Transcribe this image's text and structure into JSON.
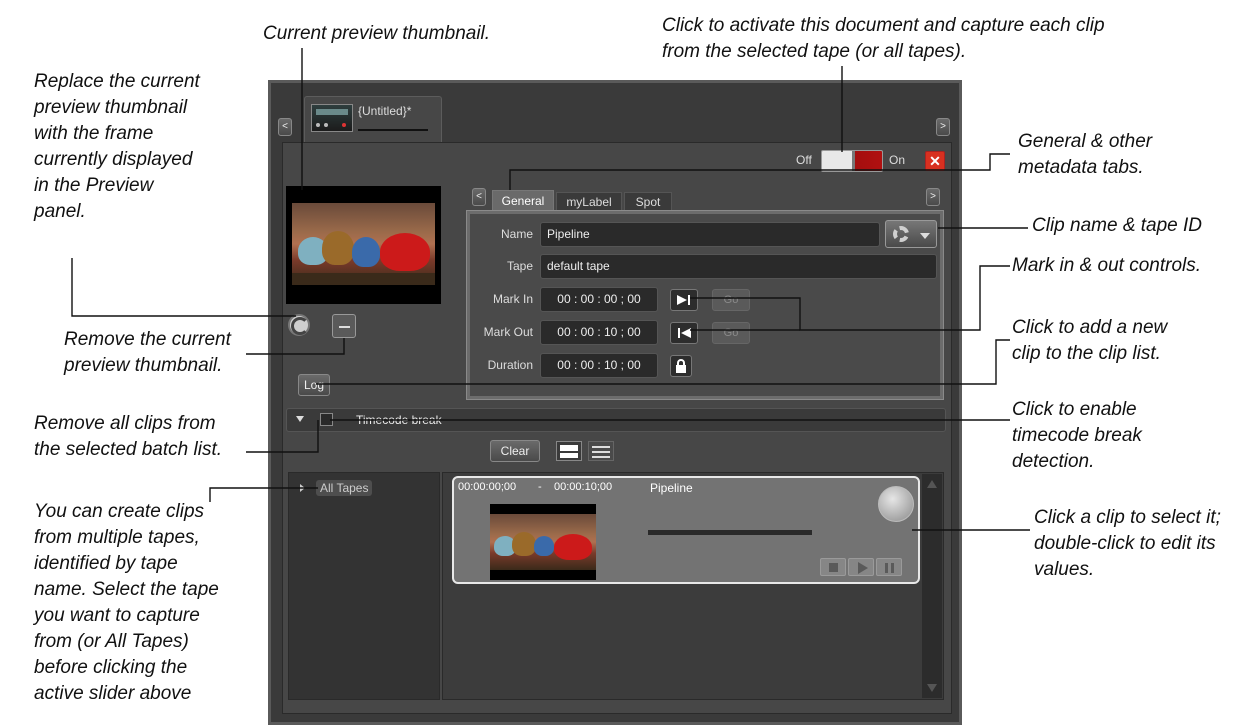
{
  "annotations": {
    "thumbnail": "Current preview thumbnail.",
    "activate_1": "Click to activate this document and capture each clip",
    "activate_2": "from the selected tape (or all tapes).",
    "replace_1": "Replace the current",
    "replace_2": "preview thumbnail",
    "replace_3": "with the frame",
    "replace_4": "currently displayed",
    "replace_5": "in the Preview",
    "replace_6": "panel.",
    "tabs_1": "General & other",
    "tabs_2": "metadata tabs.",
    "clipname": "Clip name & tape ID",
    "mark": "Mark in & out controls.",
    "remove_1": "Remove the current",
    "remove_2": "preview thumbnail.",
    "addclip_1": "Click to add a new",
    "addclip_2": "clip to the clip list.",
    "clearall_1": "Remove all clips from",
    "clearall_2": "the selected batch list.",
    "tcbreak_1": "Click to enable",
    "tcbreak_2": "timecode break",
    "tcbreak_3": "detection.",
    "tapes_1": "You can create clips",
    "tapes_2": "from multiple tapes,",
    "tapes_3": "identified by tape",
    "tapes_4": "name. Select the tape",
    "tapes_5": "you want to capture",
    "tapes_6": "from (or All Tapes)",
    "tapes_7": "before clicking the",
    "tapes_8": "active slider above",
    "select_1": "Click a clip to select it;",
    "select_2": "double-click to edit its",
    "select_3": "values."
  },
  "window": {
    "doc_tab_title": "{Untitled}*",
    "scroll_left": "<",
    "scroll_right": ">",
    "toggle_off": "Off",
    "toggle_on": "On",
    "close": "✕"
  },
  "tabs": [
    "General",
    "myLabel",
    "Spot"
  ],
  "form": {
    "name_label": "Name",
    "name_value": "Pipeline",
    "tape_label": "Tape",
    "tape_value": "default tape",
    "markin_label": "Mark In",
    "markin_value": "00 : 00 : 00 ; 00",
    "markout_label": "Mark Out",
    "markout_value": "00 : 00 : 10 ; 00",
    "duration_label": "Duration",
    "duration_value": "00 : 00 : 10 ; 00",
    "go": "Go"
  },
  "log_button": "Log",
  "timecode_break_label": "Timecode break",
  "clear_button": "Clear",
  "tape_tree": {
    "item": "All Tapes"
  },
  "clip": {
    "in": "00:00:00;00",
    "sep": "-",
    "out": "00:00:10;00",
    "name": "Pipeline"
  },
  "colors": {
    "panel": "#474747",
    "accent_red": "#b01010",
    "close_red": "#d83020"
  }
}
